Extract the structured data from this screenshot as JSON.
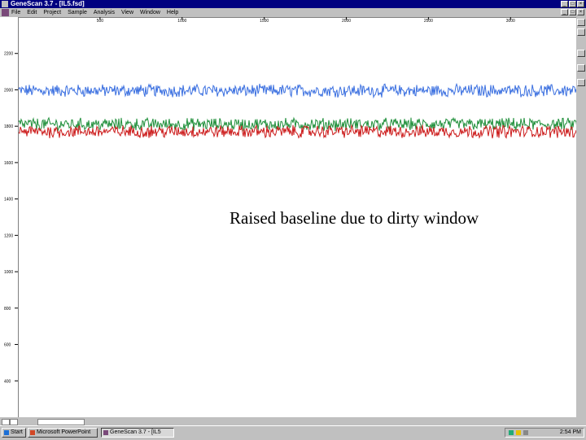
{
  "window": {
    "title": "GeneScan 3.7 - [IL5.fsd]",
    "buttons": {
      "minimize": "_",
      "maximize": "□",
      "close": "×"
    }
  },
  "menu": {
    "items": [
      "File",
      "Edit",
      "Project",
      "Sample",
      "Analysis",
      "View",
      "Window",
      "Help"
    ]
  },
  "plot": {
    "x_ticks": [
      "500",
      "1000",
      "1500",
      "2000",
      "2500",
      "3000"
    ],
    "y_ticks": [
      "2200",
      "2000",
      "1800",
      "1600",
      "1400",
      "1200",
      "1000",
      "800",
      "600",
      "400"
    ],
    "annotation": "Raised baseline due to dirty window"
  },
  "chart_data": {
    "type": "line",
    "x_ticks": [
      500,
      1000,
      1500,
      2000,
      2500,
      3000
    ],
    "y_ticks": [
      2200,
      2000,
      1800,
      1600,
      1400,
      1200,
      1000,
      800,
      600,
      400
    ],
    "xlim": [
      0,
      3400
    ],
    "ylim": [
      200,
      2400
    ],
    "series": [
      {
        "color": "#3a6fe0",
        "baseline": 2000,
        "noise": 30
      },
      {
        "color": "#1f8f3a",
        "baseline": 1815,
        "noise": 30
      },
      {
        "color": "#cc1a1a",
        "baseline": 1775,
        "noise": 30
      }
    ]
  },
  "taskbar": {
    "start_label": "Start",
    "tasks": [
      "Microsoft PowerPoint",
      "GeneScan 3.7 - [IL5"
    ],
    "clock": "2:54 PM"
  }
}
